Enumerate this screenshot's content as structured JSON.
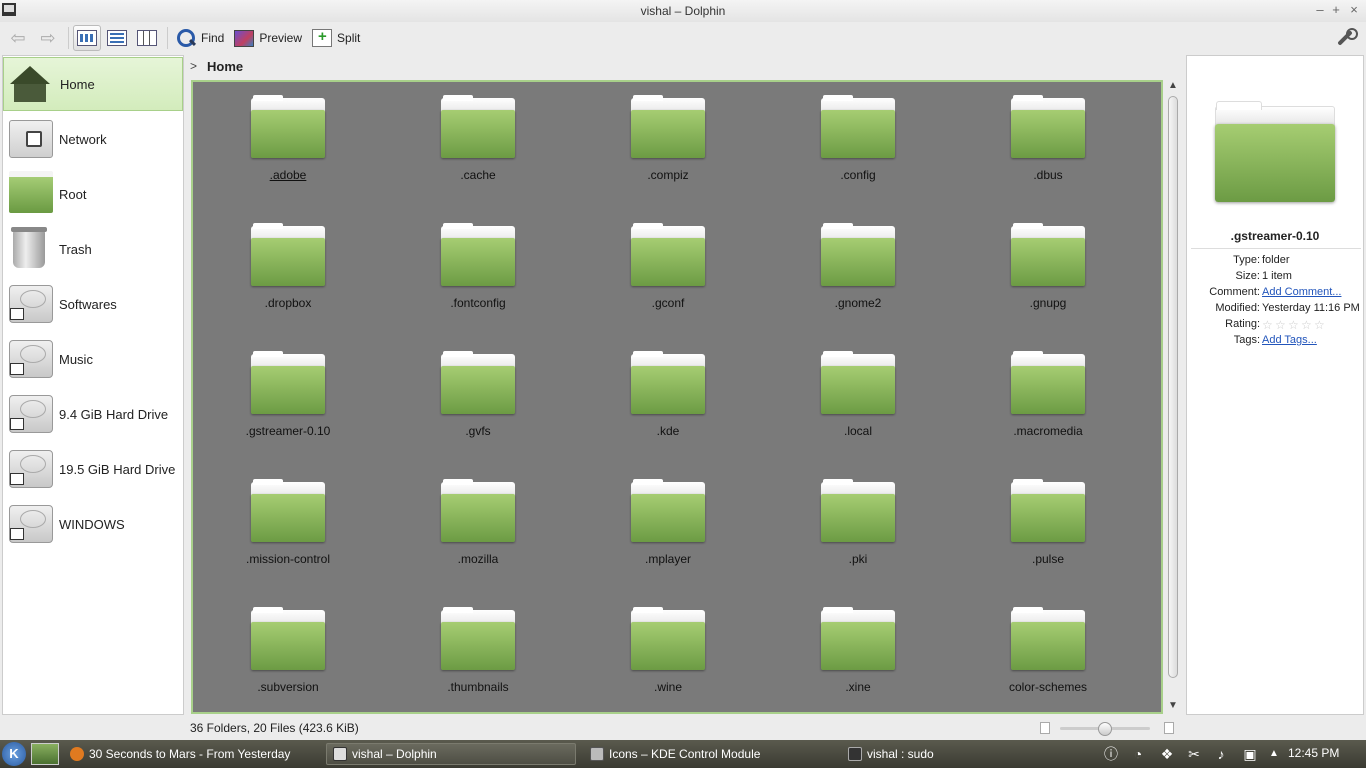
{
  "window": {
    "title": "vishal – Dolphin",
    "controls": [
      "–",
      "+",
      "×"
    ]
  },
  "toolbar": {
    "find_label": "Find",
    "preview_label": "Preview",
    "split_label": "Split"
  },
  "places": [
    {
      "label": "Home",
      "icon": "home-icon",
      "selected": true
    },
    {
      "label": "Network",
      "icon": "network-icon"
    },
    {
      "label": "Root",
      "icon": "folder-icon"
    },
    {
      "label": "Trash",
      "icon": "trash-icon"
    },
    {
      "label": "Softwares",
      "icon": "hard-drive-icon"
    },
    {
      "label": "Music",
      "icon": "hard-drive-icon"
    },
    {
      "label": "9.4 GiB Hard Drive",
      "icon": "hard-drive-icon"
    },
    {
      "label": "19.5 GiB Hard Drive",
      "icon": "hard-drive-icon"
    },
    {
      "label": "WINDOWS",
      "icon": "hard-drive-icon"
    }
  ],
  "breadcrumb": {
    "current": "Home"
  },
  "files": [
    ".adobe",
    ".cache",
    ".compiz",
    ".config",
    ".dbus",
    ".dropbox",
    ".fontconfig",
    ".gconf",
    ".gnome2",
    ".gnupg",
    ".gstreamer-0.10",
    ".gvfs",
    ".kde",
    ".local",
    ".macromedia",
    ".mission-control",
    ".mozilla",
    ".mplayer",
    ".pki",
    ".pulse",
    ".subversion",
    ".thumbnails",
    ".wine",
    ".xine",
    "color-schemes"
  ],
  "info": {
    "name": ".gstreamer-0.10",
    "rows": [
      {
        "key": "Type:",
        "value": "folder"
      },
      {
        "key": "Size:",
        "value": "1 item"
      },
      {
        "key": "Comment:",
        "value": "Add Comment...",
        "link": true
      },
      {
        "key": "Modified:",
        "value": "Yesterday 11:16 PM"
      },
      {
        "key": "Rating:",
        "value": ""
      },
      {
        "key": "Tags:",
        "value": "Add Tags...",
        "link": true
      }
    ],
    "rating": 0
  },
  "status": {
    "summary": "36 Folders, 20 Files (423.6 KiB)",
    "zoom_fraction": 0.5
  },
  "taskbar": {
    "kmenu": "K",
    "tasks": [
      {
        "label": "30 Seconds to Mars - From Yesterday",
        "icon_color": "#e07a20"
      },
      {
        "label": "vishal – Dolphin",
        "icon_color": "#dddddd",
        "active": true
      },
      {
        "label": "Icons – KDE Control Module",
        "icon_color": "#bbbbbb"
      },
      {
        "label": "vishal : sudo",
        "icon_color": "#333333"
      }
    ],
    "tray_icons": [
      "info-icon",
      "network-icon",
      "dropbox-icon",
      "clipboard-icon",
      "volume-icon",
      "battery-icon",
      "tray-arrow-icon"
    ],
    "clock": "12:45 PM"
  },
  "colors": {
    "accent_green": "#a8d08a",
    "folder_green": "#8ab85a",
    "view_background": "#7a7a7a",
    "link": "#2255bb"
  }
}
